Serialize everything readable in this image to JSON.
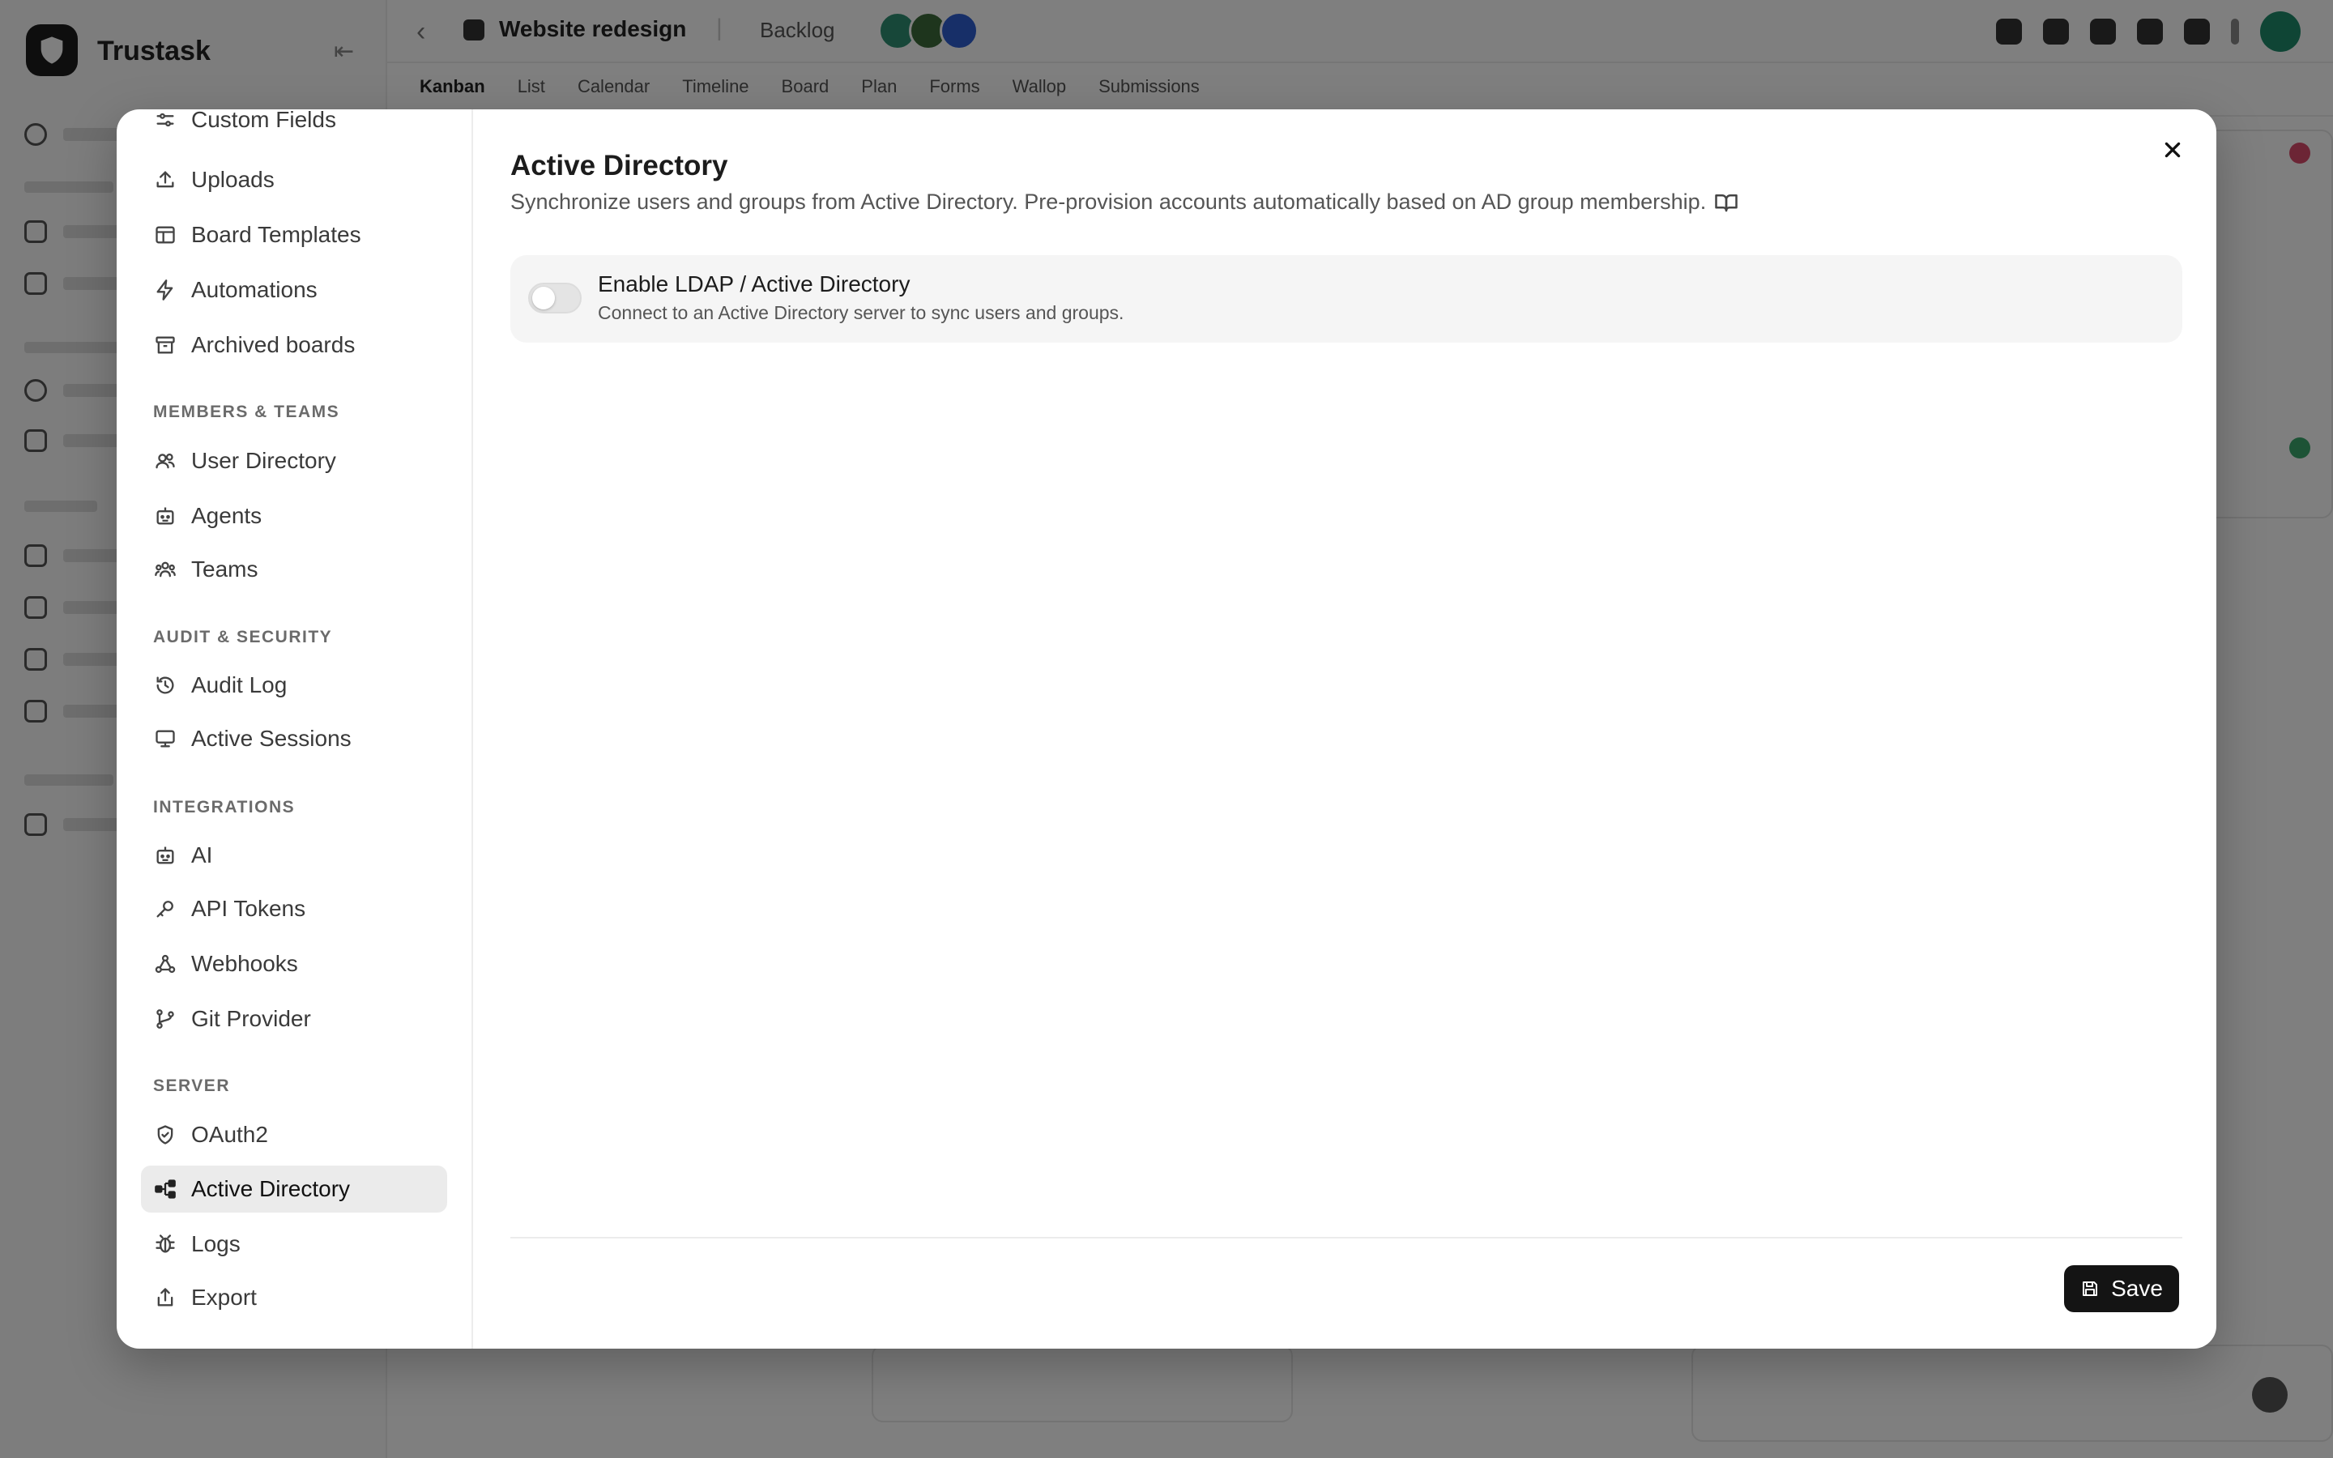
{
  "app": {
    "name": "Trustask",
    "collapse_icon": "sidebar-collapse-icon",
    "board_name": "Website redesign",
    "board_status": "Backlog",
    "view_tabs": [
      "Kanban",
      "List",
      "Calendar",
      "Timeline",
      "Board",
      "Plan",
      "Forms",
      "Wallop",
      "Submissions"
    ]
  },
  "modal": {
    "close_icon": "close-icon",
    "nav": {
      "items_top": [
        {
          "label": "Custom Fields",
          "icon": "sliders-icon"
        },
        {
          "label": "Uploads",
          "icon": "upload-icon"
        },
        {
          "label": "Board Templates",
          "icon": "template-icon"
        },
        {
          "label": "Automations",
          "icon": "lightning-icon"
        },
        {
          "label": "Archived boards",
          "icon": "archive-icon"
        }
      ],
      "sections": [
        {
          "title": "MEMBERS & TEAMS",
          "items": [
            {
              "label": "User Directory",
              "icon": "users-icon"
            },
            {
              "label": "Agents",
              "icon": "bot-icon"
            },
            {
              "label": "Teams",
              "icon": "teams-icon"
            }
          ]
        },
        {
          "title": "AUDIT & SECURITY",
          "items": [
            {
              "label": "Audit Log",
              "icon": "history-icon"
            },
            {
              "label": "Active Sessions",
              "icon": "monitor-icon"
            }
          ]
        },
        {
          "title": "INTEGRATIONS",
          "items": [
            {
              "label": "AI",
              "icon": "bot-icon"
            },
            {
              "label": "API Tokens",
              "icon": "key-icon"
            },
            {
              "label": "Webhooks",
              "icon": "webhook-icon"
            },
            {
              "label": "Git Provider",
              "icon": "git-branch-icon"
            }
          ]
        },
        {
          "title": "SERVER",
          "items": [
            {
              "label": "OAuth2",
              "icon": "shield-check-icon"
            },
            {
              "label": "Active Directory",
              "icon": "network-icon",
              "active": true
            },
            {
              "label": "Logs",
              "icon": "bug-icon"
            },
            {
              "label": "Export",
              "icon": "share-icon"
            }
          ]
        }
      ]
    },
    "content": {
      "title": "Active Directory",
      "description": "Synchronize users and groups from Active Directory. Pre-provision accounts automatically based on AD group membership.",
      "docs_icon": "book-open-icon",
      "setting": {
        "title": "Enable LDAP / Active Directory",
        "description": "Connect to an Active Directory server to sync users and groups.",
        "enabled": false
      },
      "save_label": "Save",
      "save_icon": "floppy-disk-icon"
    }
  }
}
